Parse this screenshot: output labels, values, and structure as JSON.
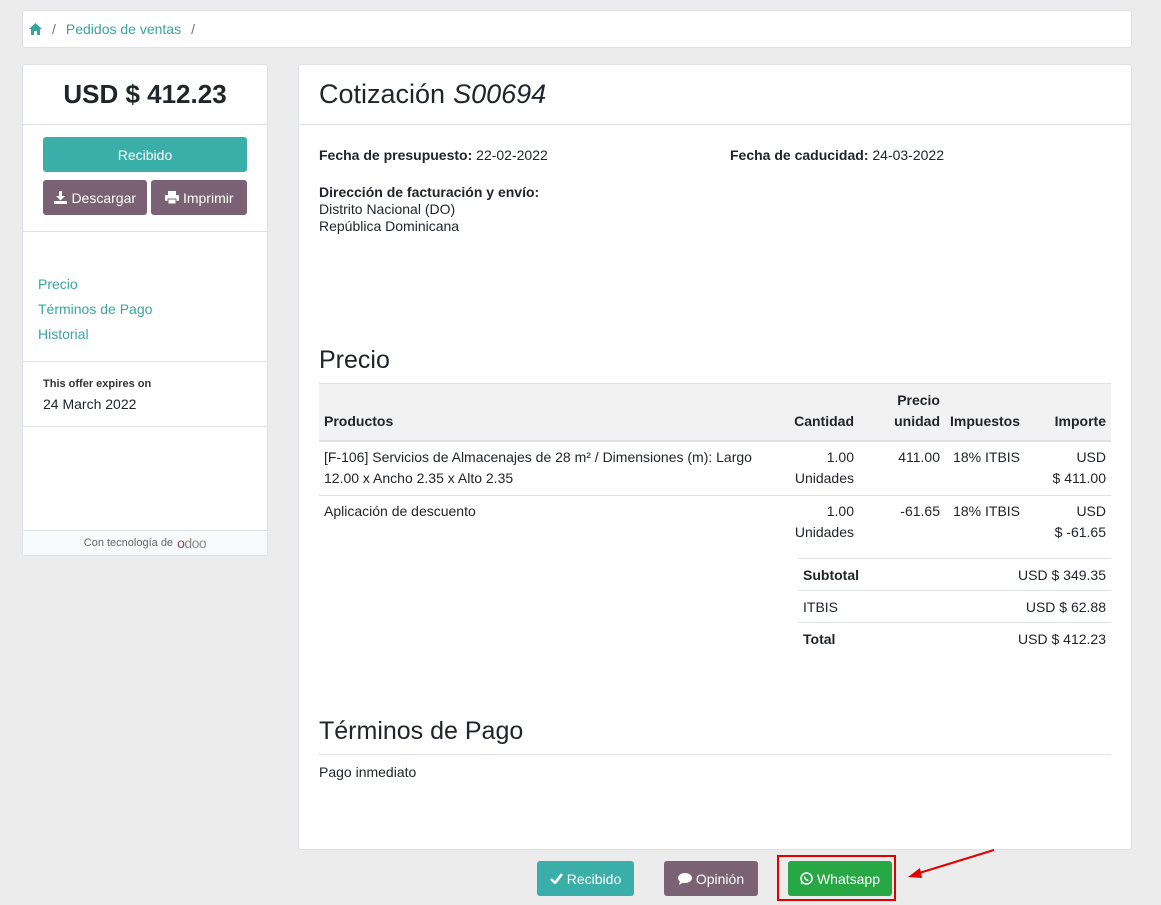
{
  "breadcrumb": {
    "home_icon": "home-icon",
    "items": [
      "Pedidos de ventas"
    ],
    "separator": "/"
  },
  "sidebar": {
    "amount": "USD $ 412.23",
    "accept_label": "Recibido",
    "download_label": "Descargar",
    "print_label": "Imprimir",
    "nav": [
      "Precio",
      "Términos de Pago",
      "Historial"
    ],
    "expires_label": "This offer expires on",
    "expires_value": "24 March 2022",
    "powered_label": "Con tecnología de",
    "powered_brand": "odoo"
  },
  "main": {
    "title": "Cotización",
    "number": "S00694",
    "quote_date_label": "Fecha de presupuesto:",
    "quote_date": "22-02-2022",
    "expiry_date_label": "Fecha de caducidad:",
    "expiry_date": "24-03-2022",
    "address_label": "Dirección de facturación y envío:",
    "address_line1": "Distrito Nacional (DO)",
    "address_line2": "República Dominicana",
    "price_heading": "Precio",
    "columns": {
      "products": "Productos",
      "qty": "Cantidad",
      "unit_price_1": "Precio",
      "unit_price_2": "unidad",
      "taxes": "Impuestos",
      "amount": "Importe"
    },
    "lines": [
      {
        "desc1": "[F-106] Servicios de Almacenajes de 28 m² / Dimensiones (m): Largo",
        "desc2": "12.00 x Ancho 2.35 x Alto 2.35",
        "qty": "1.00",
        "uom": "Unidades",
        "price": "411.00",
        "tax": "18% ITBIS",
        "cur": "USD",
        "amount": "$ 411.00"
      },
      {
        "desc1": "Aplicación de descuento",
        "desc2": "",
        "qty": "1.00",
        "uom": "Unidades",
        "price": "-61.65",
        "tax": "18% ITBIS",
        "cur": "USD",
        "amount": "$ -61.65"
      }
    ],
    "totals": {
      "subtotal_label": "Subtotal",
      "subtotal": "USD $ 349.35",
      "tax_label": "ITBIS",
      "tax": "USD $ 62.88",
      "total_label": "Total",
      "total": "USD $ 412.23"
    },
    "terms_heading": "Términos de Pago",
    "terms_text": "Pago inmediato"
  },
  "bottom_bar": {
    "accept_label": "Recibido",
    "feedback_label": "Opinión",
    "whatsapp_label": "Whatsapp"
  },
  "colors": {
    "teal": "#3aafa9",
    "purple": "#7a6274",
    "green": "#28a745",
    "highlight": "#e00000",
    "link": "#3aa5a0"
  }
}
